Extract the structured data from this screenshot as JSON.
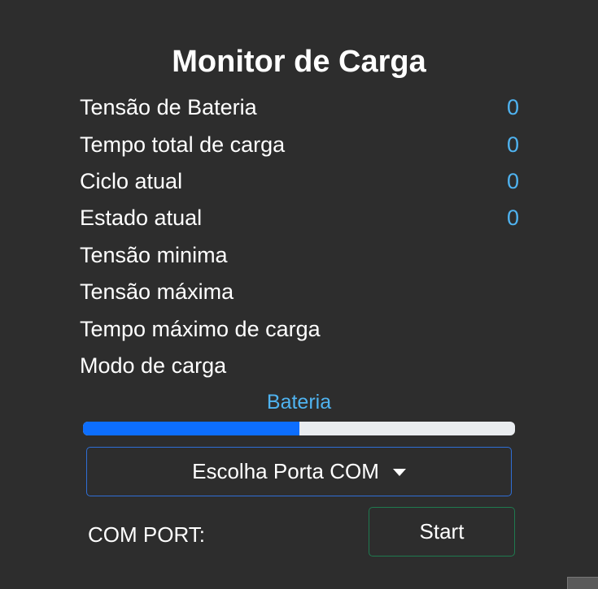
{
  "title": "Monitor de Carga",
  "rows": [
    {
      "label": "Tensão de Bateria",
      "value": "0"
    },
    {
      "label": "Tempo total de carga",
      "value": "0"
    },
    {
      "label": "Ciclo atual",
      "value": "0"
    },
    {
      "label": "Estado atual",
      "value": "0"
    },
    {
      "label": "Tensão minima",
      "value": ""
    },
    {
      "label": "Tensão máxima",
      "value": ""
    },
    {
      "label": "Tempo máximo de carga",
      "value": ""
    },
    {
      "label": "Modo de carga",
      "value": ""
    }
  ],
  "battery": {
    "label": "Bateria",
    "progress_percent": 50,
    "fill_color": "#0d6efd",
    "track_color": "#e9ecef"
  },
  "port_select": {
    "label": "Escolha Porta COM",
    "icon": "caret-down-icon"
  },
  "com_port": {
    "label": "COM PORT:",
    "value": ""
  },
  "start_button": {
    "label": "Start",
    "border_color": "#1f7a4f"
  },
  "colors": {
    "background": "#2d2d2d",
    "value_accent": "#4fb3f0",
    "select_border": "#2f6fd6"
  }
}
